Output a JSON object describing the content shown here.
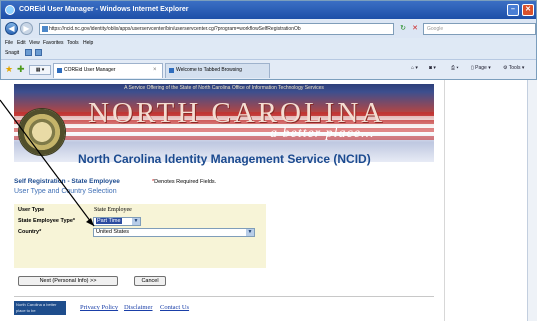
{
  "window": {
    "title": "COREid User Manager - Windows Internet Explorer"
  },
  "navigation": {
    "url": "https://ncid.nc.gov/identity/oblix/apps/userservcenter/bin/userservcenter.cgi?program=workflowSelfRegistrationOb",
    "search_placeholder": "Google"
  },
  "menubar": [
    "File",
    "Edit",
    "View",
    "Favorites",
    "Tools",
    "Help"
  ],
  "links_bar": {
    "snagit_label": "Snagit"
  },
  "tabs": [
    {
      "label": "COREid User Manager",
      "active": true
    },
    {
      "label": "Welcome to Tabbed Browsing",
      "active": false
    }
  ],
  "toolbar": {
    "page_label": "Page",
    "tools_label": "Tools"
  },
  "banner": {
    "strip_text": "A Service Offering of the State of North Carolina Office of Information Technology Services",
    "title": "NORTH CAROLINA",
    "tagline": "a better place..."
  },
  "page": {
    "agency_title": "North Carolina Identity Management Service (NCID)",
    "registration_title": "Self Registration - State Employee",
    "required_note_star": "*",
    "required_note": "Denotes Required Fields.",
    "section_subtitle": "User Type and Country Selection"
  },
  "form": {
    "user_type_label": "User Type",
    "user_type_value": "State Employee",
    "employee_type_label": "State Employee Type*",
    "employee_type_value": "Part Time",
    "country_label": "Country*",
    "country_value": "United States"
  },
  "buttons": {
    "next_label": "Next (Personal Info) >>",
    "cancel_label": "Cancel"
  },
  "footer": {
    "logo_text": "North Carolina a better place to be",
    "links": [
      "Privacy Policy",
      "Disclaimer",
      "Contact Us"
    ]
  }
}
